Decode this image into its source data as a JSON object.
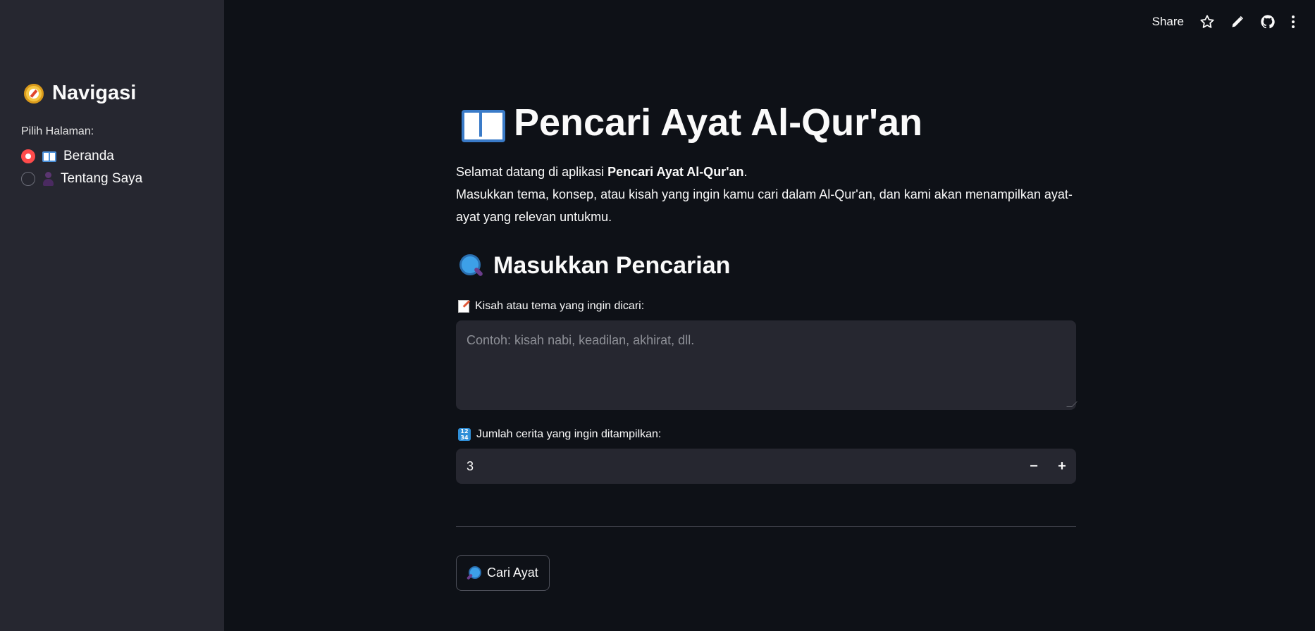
{
  "toolbar": {
    "share_label": "Share",
    "icons": [
      "star-icon",
      "pencil-icon",
      "github-icon",
      "more-vertical-icon"
    ]
  },
  "sidebar": {
    "title": "Navigasi",
    "title_icon": "compass-icon",
    "radio_label": "Pilih Halaman:",
    "options": [
      {
        "icon": "book-icon",
        "label": "Beranda",
        "selected": true
      },
      {
        "icon": "person-icon",
        "label": "Tentang Saya",
        "selected": false
      }
    ]
  },
  "main": {
    "title": "Pencari Ayat Al-Qur'an",
    "title_icon": "open-book-icon",
    "intro": {
      "line1_prefix": "Selamat datang di aplikasi ",
      "line1_bold": "Pencari Ayat Al-Qur'an",
      "line1_suffix": ".",
      "line2": "Masukkan tema, konsep, atau kisah yang ingin kamu cari dalam Al-Qur'an, dan kami akan menampilkan ayat-ayat yang relevan untukmu."
    },
    "section_title": "Masukkan Pencarian",
    "section_icon": "magnifier-icon",
    "query": {
      "label": "Kisah atau tema yang ingin dicari:",
      "icon": "memo-icon",
      "placeholder": "Contoh: kisah nabi, keadilan, akhirat, dll.",
      "value": ""
    },
    "count": {
      "label": "Jumlah cerita yang ingin ditampilkan:",
      "icon": "numbers-icon",
      "value": "3",
      "decrement": "−",
      "increment": "+"
    },
    "search_button": {
      "label": "Cari Ayat",
      "icon": "magnifier-icon"
    }
  },
  "colors": {
    "background": "#0e1117",
    "sidebar": "#262730",
    "accent": "#ff4b4b"
  }
}
